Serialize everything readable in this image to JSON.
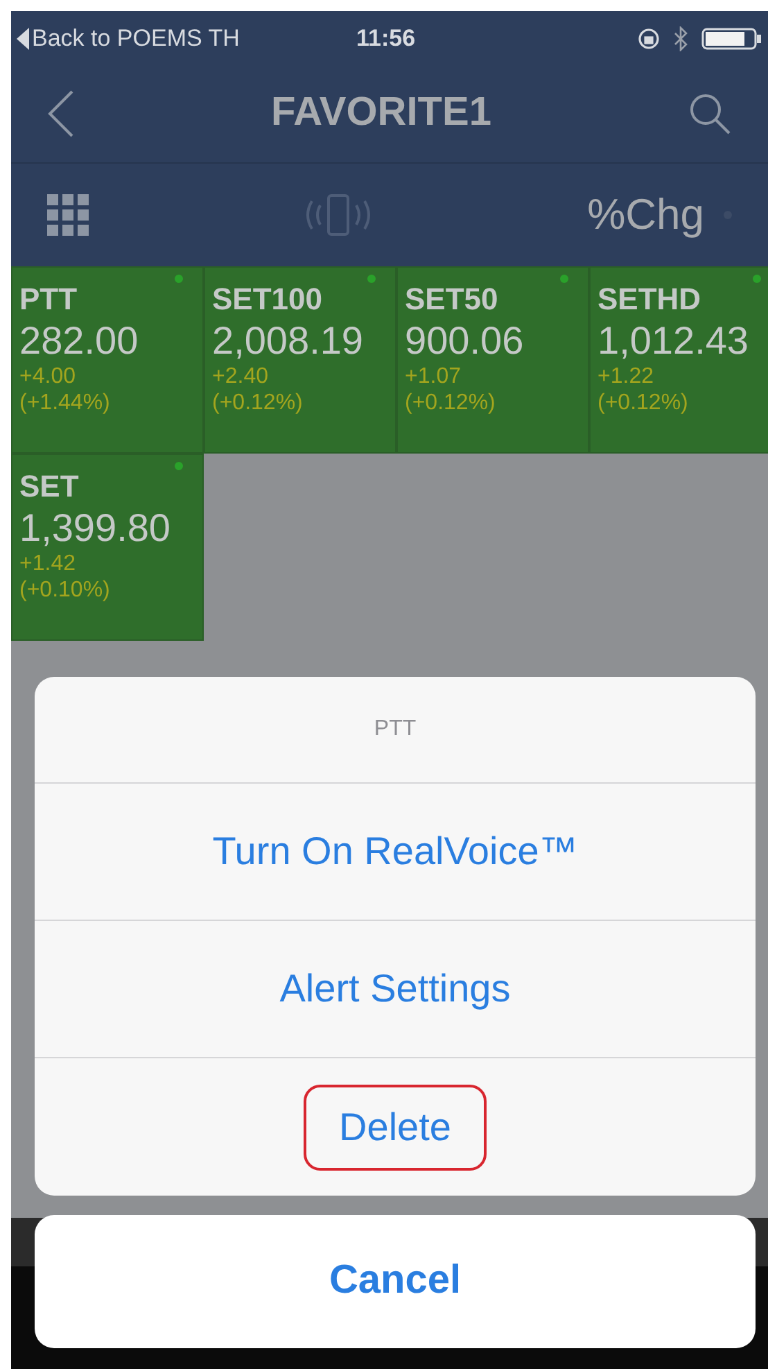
{
  "status_bar": {
    "back_label": "Back to POEMS TH",
    "time": "11:56"
  },
  "nav_bar": {
    "title": "FAVORITE1"
  },
  "toolbar": {
    "sort_label": "%Chg"
  },
  "tiles": [
    {
      "name": "PTT",
      "price": "282.00",
      "change": "+4.00",
      "percent": "(+1.44%)"
    },
    {
      "name": "SET100",
      "price": "2,008.19",
      "change": "+2.40",
      "percent": "(+0.12%)"
    },
    {
      "name": "SET50",
      "price": "900.06",
      "change": "+1.07",
      "percent": "(+0.12%)"
    },
    {
      "name": "SETHD",
      "price": "1,012.43",
      "change": "+1.22",
      "percent": "(+0.12%)"
    },
    {
      "name": "SET",
      "price": "1,399.80",
      "change": "+1.42",
      "percent": "(+0.10%)"
    }
  ],
  "action_sheet": {
    "title": "PTT",
    "actions": [
      {
        "label": "Turn On RealVoice™",
        "highlighted": false
      },
      {
        "label": "Alert Settings",
        "highlighted": false
      },
      {
        "label": "Delete",
        "highlighted": true
      }
    ],
    "cancel": "Cancel"
  }
}
